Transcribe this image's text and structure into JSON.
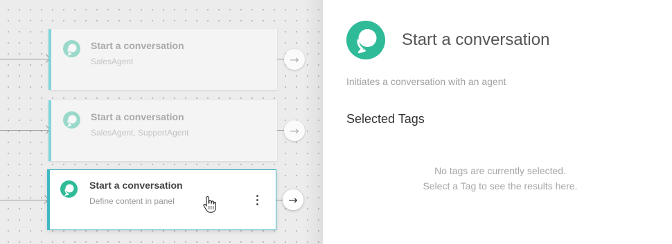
{
  "canvas": {
    "nodes": [
      {
        "title": "Start a conversation",
        "subtitle": "SalesAgent",
        "state": "faded",
        "icon": "chat-bubble-icon"
      },
      {
        "title": "Start a conversation",
        "subtitle": "SalesAgent, SupportAgent",
        "state": "faded",
        "icon": "chat-bubble-icon"
      },
      {
        "title": "Start a conversation",
        "subtitle": "Define content in panel",
        "state": "active",
        "icon": "chat-bubble-icon"
      }
    ],
    "out_arrow_glyph": "→"
  },
  "panel": {
    "icon": "chat-bubble-icon",
    "title": "Start a conversation",
    "description": "Initiates a conversation with an agent",
    "tags_heading": "Selected Tags",
    "empty_line1": "No tags are currently selected.",
    "empty_line2": "Select a Tag to see the results here."
  },
  "colors": {
    "accent": "#2fba98",
    "selection_border": "#3fb7c5"
  }
}
